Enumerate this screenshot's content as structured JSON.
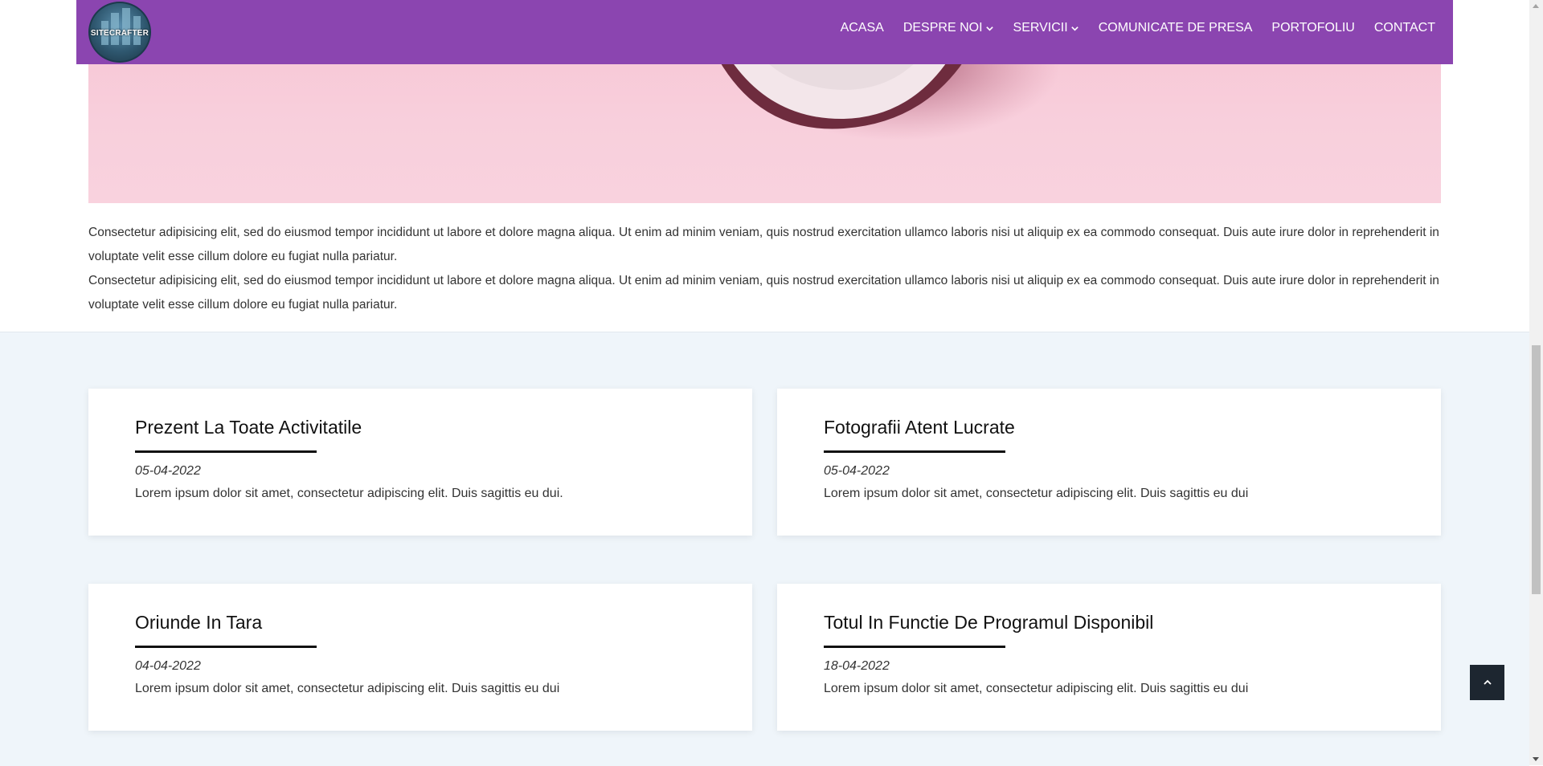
{
  "header": {
    "logo_text": "SITECRAFTER",
    "nav": [
      {
        "label": "ACASA",
        "dropdown": false
      },
      {
        "label": "DESPRE NOI",
        "dropdown": true
      },
      {
        "label": "SERVICII",
        "dropdown": true
      },
      {
        "label": "COMUNICATE DE PRESA",
        "dropdown": false
      },
      {
        "label": "PORTOFOLIU",
        "dropdown": false
      },
      {
        "label": "CONTACT",
        "dropdown": false
      }
    ],
    "accent_color": "#8b45b0"
  },
  "content": {
    "paragraphs": [
      "Consectetur adipisicing elit, sed do eiusmod tempor incididunt ut labore et dolore magna aliqua. Ut enim ad minim veniam, quis nostrud exercitation ullamco laboris nisi ut aliquip ex ea commodo consequat. Duis aute irure dolor in reprehenderit in voluptate velit esse cillum dolore eu fugiat nulla pariatur.",
      "Consectetur adipisicing elit, sed do eiusmod tempor incididunt ut labore et dolore magna aliqua. Ut enim ad minim veniam, quis nostrud exercitation ullamco laboris nisi ut aliquip ex ea commodo consequat. Duis aute irure dolor in reprehenderit in voluptate velit esse cillum dolore eu fugiat nulla pariatur."
    ]
  },
  "cards": [
    {
      "title": "Prezent La Toate Activitatile",
      "date": "05-04-2022",
      "description": "Lorem ipsum dolor sit amet, consectetur adipiscing elit. Duis sagittis eu dui."
    },
    {
      "title": "Fotografii Atent Lucrate",
      "date": "05-04-2022",
      "description": "Lorem ipsum dolor sit amet, consectetur adipiscing elit. Duis sagittis eu dui"
    },
    {
      "title": "Oriunde In Tara",
      "date": "04-04-2022",
      "description": "Lorem ipsum dolor sit amet, consectetur adipiscing elit. Duis sagittis eu dui"
    },
    {
      "title": "Totul In Functie De Programul Disponibil",
      "date": "18-04-2022",
      "description": "Lorem ipsum dolor sit amet, consectetur adipiscing elit. Duis sagittis eu dui"
    }
  ],
  "icons": {
    "chevron": "chevron-down-icon",
    "back_to_top": "chevron-up-icon"
  }
}
